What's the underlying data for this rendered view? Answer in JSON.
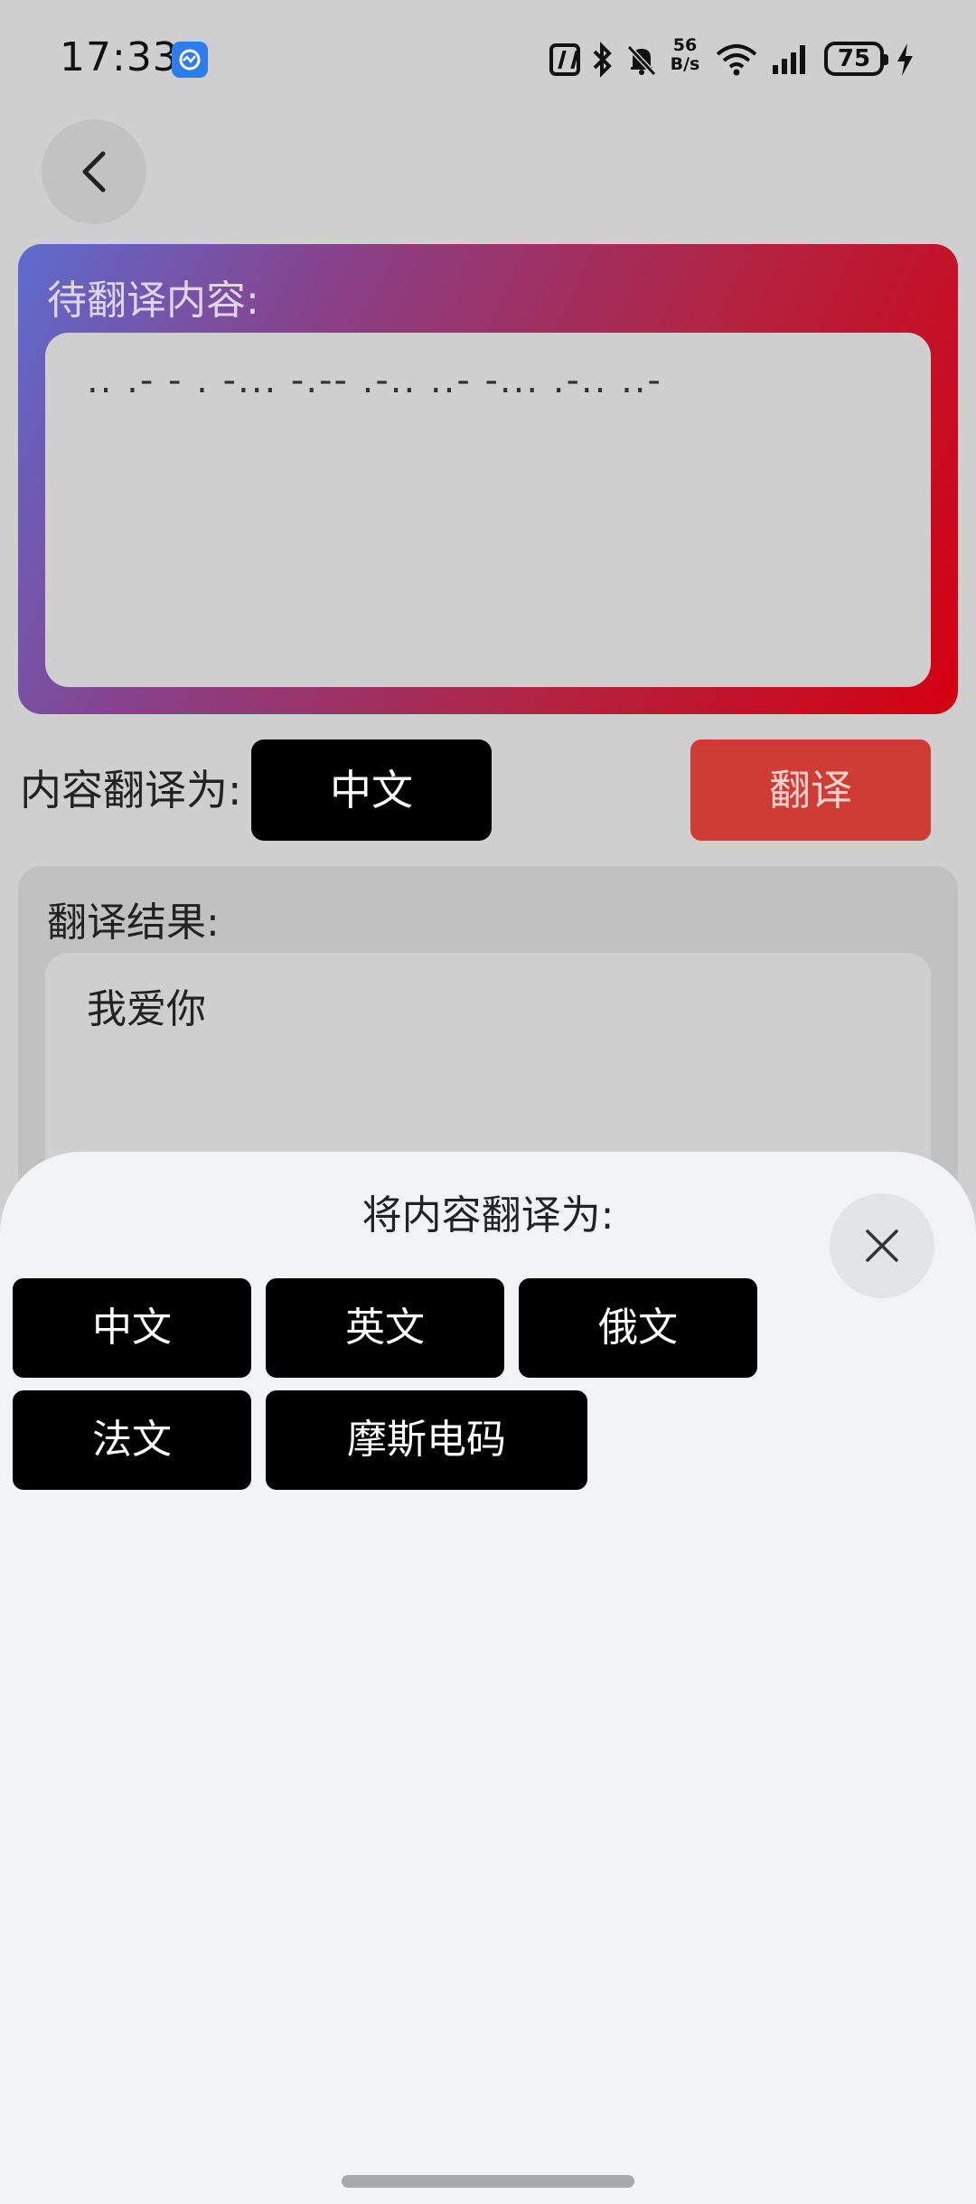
{
  "status_bar": {
    "time": "17:33",
    "net_speed_value": "56",
    "net_speed_unit": "B/s",
    "battery": "75",
    "icons": [
      "monitor-app-icon",
      "nfc-icon",
      "bluetooth-icon",
      "bell-muted-icon",
      "wifi-icon",
      "signal-icon",
      "battery-icon",
      "charging-icon"
    ]
  },
  "header": {
    "back_icon": "back-chevron-icon"
  },
  "input": {
    "label": "待翻译内容:",
    "value": ".. .-  -  . -... -.-- .-.. ..- -... .-.. ..-"
  },
  "controls": {
    "target_label": "内容翻译为:",
    "target_value": "中文",
    "translate_label": "翻译"
  },
  "result": {
    "label": "翻译结果:",
    "value": "我爱你"
  },
  "sheet": {
    "title": "将内容翻译为:",
    "close_icon": "close-icon",
    "options": [
      "中文",
      "英文",
      "俄文",
      "法文",
      "摩斯电码"
    ]
  },
  "colors": {
    "page_bg": "#cfcfcf",
    "gradient_start": "#5e6ccf",
    "gradient_end": "#d40010",
    "translate_button": "#cf3c33",
    "chip_bg": "#000000",
    "sheet_bg": "#f2f3f5"
  }
}
